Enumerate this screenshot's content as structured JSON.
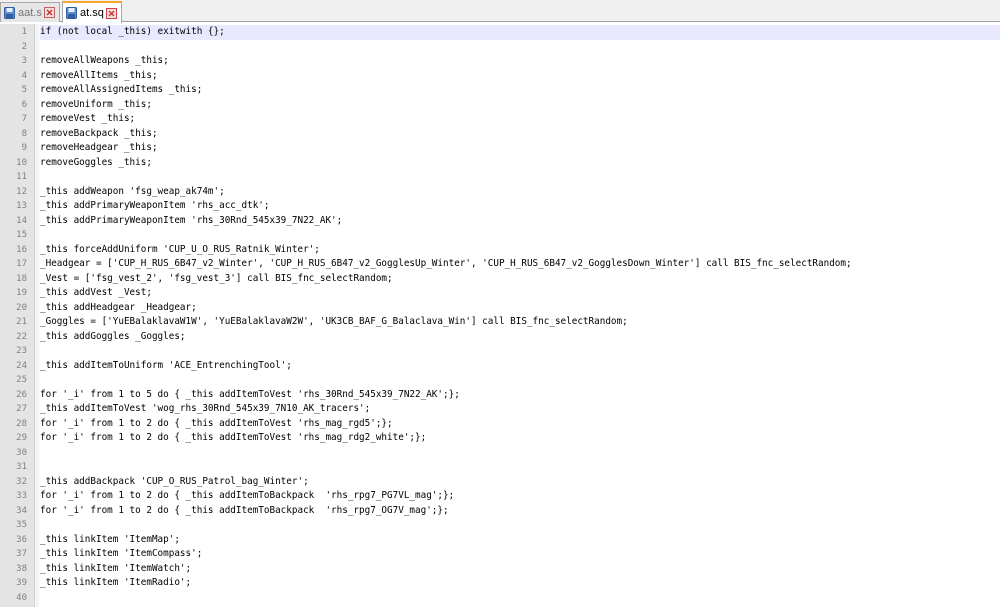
{
  "tabs": [
    {
      "label": "aat.sqf",
      "active": false
    },
    {
      "label": "at.sqf",
      "active": true
    }
  ],
  "colors": {
    "accent": "#f6a830",
    "current_line": "#e8e8ff",
    "close_red": "#d04040"
  },
  "icons": {
    "file": "floppy-disk-icon",
    "close": "close-icon"
  },
  "editor": {
    "current_line": 1,
    "lines": [
      {
        "n": "1",
        "text": "if (not local _this) exitwith {};"
      },
      {
        "n": "2",
        "text": ""
      },
      {
        "n": "3",
        "text": "removeAllWeapons _this;"
      },
      {
        "n": "4",
        "text": "removeAllItems _this;"
      },
      {
        "n": "5",
        "text": "removeAllAssignedItems _this;"
      },
      {
        "n": "6",
        "text": "removeUniform _this;"
      },
      {
        "n": "7",
        "text": "removeVest _this;"
      },
      {
        "n": "8",
        "text": "removeBackpack _this;"
      },
      {
        "n": "9",
        "text": "removeHeadgear _this;"
      },
      {
        "n": "10",
        "text": "removeGoggles _this;"
      },
      {
        "n": "11",
        "text": ""
      },
      {
        "n": "12",
        "text": "_this addWeapon 'fsg_weap_ak74m';"
      },
      {
        "n": "13",
        "text": "_this addPrimaryWeaponItem 'rhs_acc_dtk';"
      },
      {
        "n": "14",
        "text": "_this addPrimaryWeaponItem 'rhs_30Rnd_545x39_7N22_AK';"
      },
      {
        "n": "15",
        "text": ""
      },
      {
        "n": "16",
        "text": "_this forceAddUniform 'CUP_U_O_RUS_Ratnik_Winter';"
      },
      {
        "n": "17",
        "text": "_Headgear = ['CUP_H_RUS_6B47_v2_Winter', 'CUP_H_RUS_6B47_v2_GogglesUp_Winter', 'CUP_H_RUS_6B47_v2_GogglesDown_Winter'] call BIS_fnc_selectRandom;"
      },
      {
        "n": "18",
        "text": "_Vest = ['fsg_vest_2', 'fsg_vest_3'] call BIS_fnc_selectRandom;"
      },
      {
        "n": "19",
        "text": "_this addVest _Vest;"
      },
      {
        "n": "20",
        "text": "_this addHeadgear _Headgear;"
      },
      {
        "n": "21",
        "text": "_Goggles = ['YuEBalaklavaW1W', 'YuEBalaklavaW2W', 'UK3CB_BAF_G_Balaclava_Win'] call BIS_fnc_selectRandom;"
      },
      {
        "n": "22",
        "text": "_this addGoggles _Goggles;"
      },
      {
        "n": "23",
        "text": ""
      },
      {
        "n": "24",
        "text": "_this addItemToUniform 'ACE_EntrenchingTool';"
      },
      {
        "n": "25",
        "text": ""
      },
      {
        "n": "26",
        "text": "for '_i' from 1 to 5 do { _this addItemToVest 'rhs_30Rnd_545x39_7N22_AK';};"
      },
      {
        "n": "27",
        "text": "_this addItemToVest 'wog_rhs_30Rnd_545x39_7N10_AK_tracers';"
      },
      {
        "n": "28",
        "text": "for '_i' from 1 to 2 do { _this addItemToVest 'rhs_mag_rgd5';};"
      },
      {
        "n": "29",
        "text": "for '_i' from 1 to 2 do { _this addItemToVest 'rhs_mag_rdg2_white';};"
      },
      {
        "n": "30",
        "text": ""
      },
      {
        "n": "31",
        "text": ""
      },
      {
        "n": "32",
        "text": "_this addBackpack 'CUP_O_RUS_Patrol_bag_Winter';"
      },
      {
        "n": "33",
        "text": "for '_i' from 1 to 2 do { _this addItemToBackpack  'rhs_rpg7_PG7VL_mag';};"
      },
      {
        "n": "34",
        "text": "for '_i' from 1 to 2 do { _this addItemToBackpack  'rhs_rpg7_OG7V_mag';};"
      },
      {
        "n": "35",
        "text": ""
      },
      {
        "n": "36",
        "text": "_this linkItem 'ItemMap';"
      },
      {
        "n": "37",
        "text": "_this linkItem 'ItemCompass';"
      },
      {
        "n": "38",
        "text": "_this linkItem 'ItemWatch';"
      },
      {
        "n": "39",
        "text": "_this linkItem 'ItemRadio';"
      },
      {
        "n": "40",
        "text": ""
      }
    ]
  }
}
